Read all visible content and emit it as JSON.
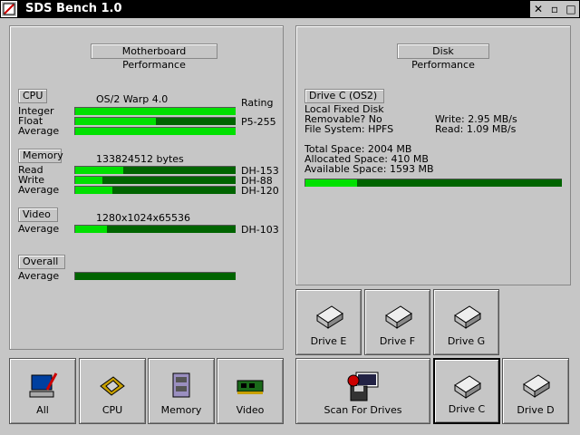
{
  "window": {
    "title": "SDS Bench 1.0"
  },
  "motherboard": {
    "group_title": "Motherboard Performance",
    "cpu": {
      "label": "CPU",
      "info": "OS/2 Warp 4.0",
      "rating_label": "Rating",
      "rows": [
        {
          "label": "Integer",
          "fill": 1.0,
          "rating": ""
        },
        {
          "label": "Float",
          "fill": 0.5,
          "rating": "P5-255"
        },
        {
          "label": "Average",
          "fill": 1.0,
          "rating": ""
        }
      ]
    },
    "memory": {
      "label": "Memory",
      "info": "133824512 bytes",
      "rows": [
        {
          "label": "Read",
          "fill": 0.3,
          "rating": "DH-153"
        },
        {
          "label": "Write",
          "fill": 0.17,
          "rating": "DH-88"
        },
        {
          "label": "Average",
          "fill": 0.23,
          "rating": "DH-120"
        }
      ]
    },
    "video": {
      "label": "Video",
      "info": "1280x1024x65536",
      "rows": [
        {
          "label": "Average",
          "fill": 0.2,
          "rating": "DH-103"
        }
      ]
    },
    "overall": {
      "label": "Overall",
      "rows": [
        {
          "label": "Average",
          "fill": 0.0,
          "rating": ""
        }
      ]
    }
  },
  "disk": {
    "group_title": "Disk Performance",
    "drive_label": "Drive C (OS2)",
    "type": "Local Fixed Disk",
    "removable": "Removable? No",
    "fs": "File System: HPFS",
    "write": "Write: 2.95 MB/s",
    "read": "Read: 1.09 MB/s",
    "total": "Total Space: 2004 MB",
    "allocated": "Allocated Space: 410 MB",
    "available": "Available Space: 1593 MB",
    "used_fraction": 0.2
  },
  "buttons": {
    "all": "All",
    "cpu": "CPU",
    "memory": "Memory",
    "video": "Video",
    "scan": "Scan  For Drives",
    "drive_c": "Drive C",
    "drive_d": "Drive D",
    "drive_e": "Drive E",
    "drive_f": "Drive F",
    "drive_g": "Drive G"
  }
}
